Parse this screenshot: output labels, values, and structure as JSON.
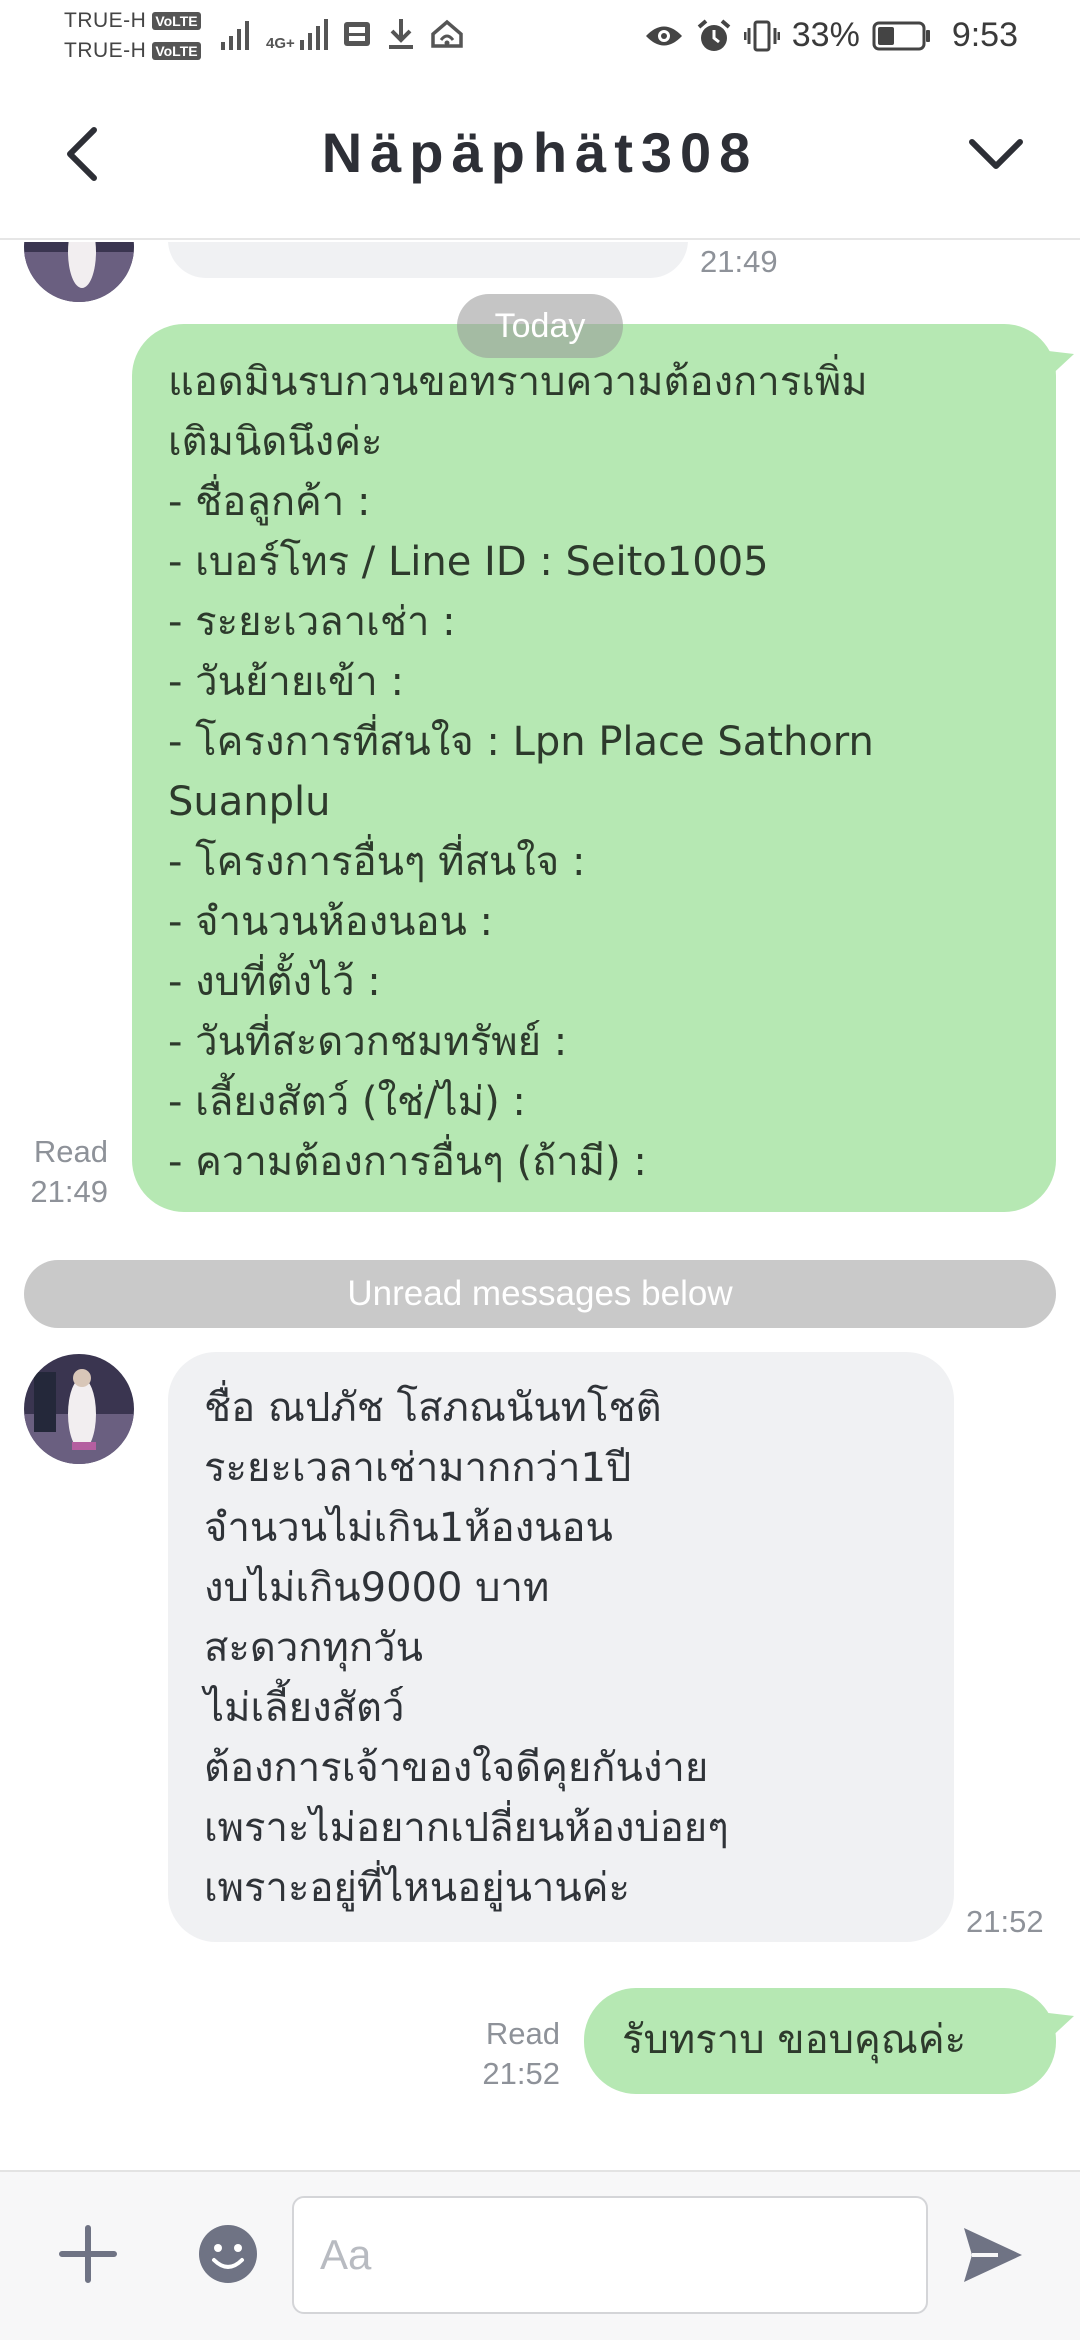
{
  "status_bar": {
    "carrier_1": "TRUE-H",
    "carrier_2": "TRUE-H",
    "volte_label": "VoLTE",
    "network_label": "4G+",
    "battery_percent": "33%",
    "time": "9:53",
    "icons": [
      "signal-icon",
      "signal-4g-icon",
      "data-saver-icon",
      "download-icon",
      "wifi-hotspot-icon",
      "eye-icon",
      "alarm-icon",
      "vibrate-icon",
      "battery-icon"
    ]
  },
  "header": {
    "title": "Näpäphät308",
    "back_icon": "chevron-left-icon",
    "collapse_icon": "chevron-down-icon"
  },
  "messages": {
    "prev_incoming_time": "21:49",
    "today_label": "Today",
    "outgoing_1": {
      "lines": [
        "แอดมินรบกวนขอทราบความต้องการเพิ่ม",
        "เติมนิดนึงค่ะ",
        "- ชื่อลูกค้า :",
        "- เบอร์โทร / Line ID : Seito1005",
        "- ระยะเวลาเช่า :",
        "- วันย้ายเข้า :",
        "- โครงการที่สนใจ : Lpn Place Sathorn",
        "Suanplu",
        "- โครงการอื่นๆ ที่สนใจ :",
        "- จำนวนห้องนอน :",
        "- งบที่ตั้งไว้ :",
        "- วันที่สะดวกชมทรัพย์ :",
        "- เลี้ยงสัตว์ (ใช่/ไม่) :",
        "- ความต้องการอื่นๆ (ถ้ามี) :"
      ],
      "read_label": "Read",
      "time": "21:49"
    },
    "unread_label": "Unread messages below",
    "incoming_1": {
      "lines": [
        "ชื่อ ณปภัช โสภณนันทโชติ",
        "ระยะเวลาเช่ามากกว่า1ปี",
        "จำนวนไม่เกิน1ห้องนอน",
        "งบไม่เกิน9000 บาท",
        "สะดวกทุกวัน",
        "ไม่เลี้ยงสัตว์",
        "ต้องการเจ้าของใจดีคุยกันง่าย",
        "เพราะไม่อยากเปลี่ยนห้องบ่อยๆ",
        "เพราะอยู่ที่ไหนอยู่นานค่ะ"
      ],
      "time": "21:52"
    },
    "outgoing_2": {
      "text": "รับทราบ ขอบคุณค่ะ",
      "read_label": "Read",
      "time": "21:52"
    }
  },
  "input_bar": {
    "placeholder": "Aa",
    "plus_icon": "plus-icon",
    "emoji_icon": "emoji-icon",
    "send_icon": "send-icon"
  },
  "colors": {
    "outgoing_bubble": "#b6e8b3",
    "incoming_bubble": "#f0f1f3",
    "meta_text": "#8e9299",
    "unread_bar": "#c9c9c9",
    "icon_gray": "#6f7384"
  }
}
